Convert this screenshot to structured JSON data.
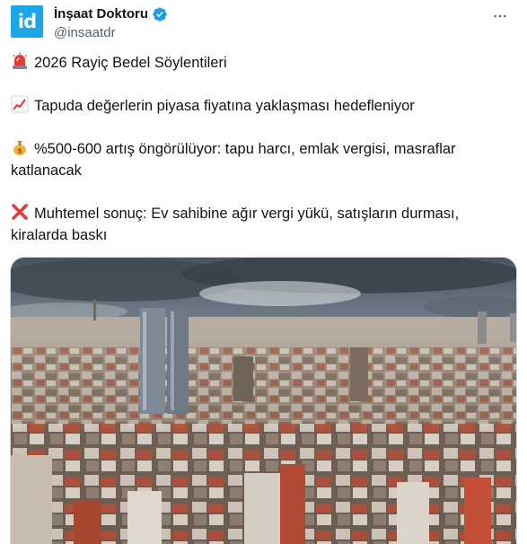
{
  "author": {
    "display_name": "İnşaat Doktoru",
    "handle": "@insaatdr",
    "avatar_text": "id",
    "verified": true
  },
  "icons": {
    "verified": "verified-badge-icon",
    "more": "more-horizontal-icon",
    "siren": "siren-emoji",
    "chart": "chart-increasing-emoji",
    "money": "money-bag-emoji",
    "cross": "cross-mark-emoji"
  },
  "tweet": {
    "line1": "2026 Rayiç Bedel Söylentileri",
    "line2": "Tapuda değerlerin piyasa fiyatına yaklaşması hedefleniyor",
    "line3a": "%500-600 artış öngörülüyor: tapu harcı, emlak vergisi, masraflar",
    "line3b": "katlanacak",
    "line4a": "Muhtemel sonuç: Ev sahibine ağır vergi yükü, satışların durması,",
    "line4b": "kiralarda baskı"
  },
  "colors": {
    "brand": "#1d9bf0",
    "avatar": "#1aa6e7",
    "text": "#0f1419",
    "muted": "#536471"
  }
}
